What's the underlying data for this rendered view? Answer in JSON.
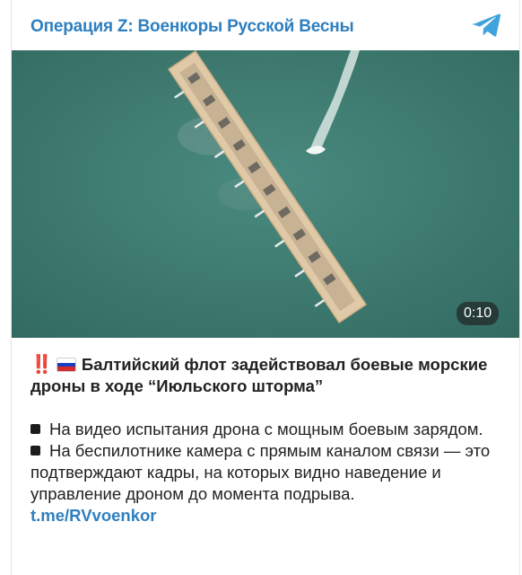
{
  "header": {
    "channel_name": "Операция Z: Военкоры Русской Весны",
    "channel_icon": "telegram-icon",
    "accent_color": "#2e7fc0"
  },
  "video": {
    "duration": "0:10"
  },
  "post": {
    "lead_emoji": "‼️",
    "flag_icon": "russia-flag-icon",
    "title": "Балтийский флот задействовал боевые морские дроны в ходе “Июльского шторма”",
    "bullet_1": "На видео испытания дрона с мощным боевым зарядом.",
    "bullet_2": "На беспилотнике камера с прямым каналом связи — это подтверждают кадры, на которых видно наведение и управление дроном до момента подрыва.",
    "link": "t.me/RVvoenkor"
  }
}
